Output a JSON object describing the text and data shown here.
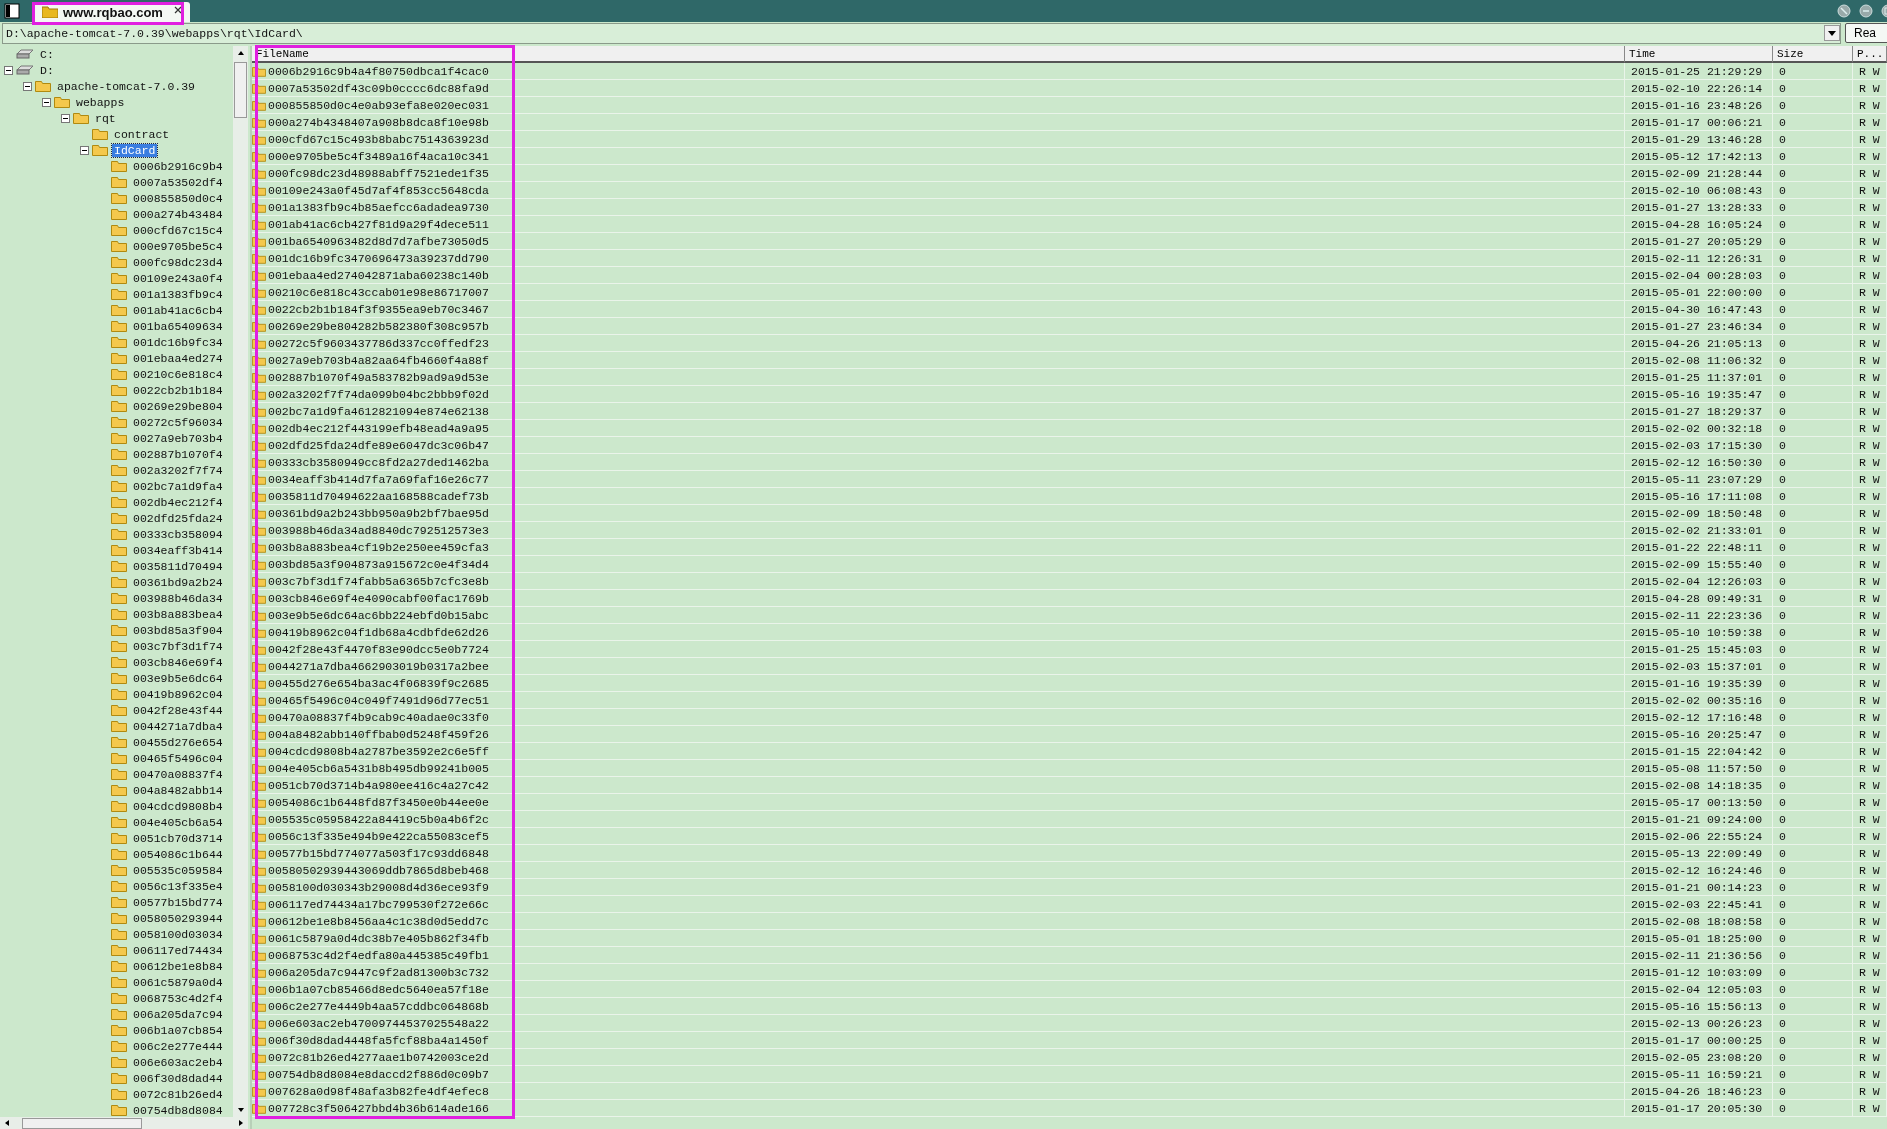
{
  "window": {
    "tab": "www.rqbao.com"
  },
  "address_bar": {
    "path": "D:\\apache-tomcat-7.0.39\\webapps\\rqt\\IdCard\\",
    "button": "Rea"
  },
  "tree": [
    {
      "label": "C:",
      "kind": "drive",
      "selected": false
    },
    {
      "label": "D:",
      "kind": "drive",
      "selected": false,
      "expanded": true,
      "children": [
        {
          "label": "apache-tomcat-7.0.39",
          "kind": "folder",
          "selected": false,
          "expanded": true,
          "children": [
            {
              "label": "webapps",
              "kind": "folder",
              "selected": false,
              "expanded": true,
              "children": [
                {
                  "label": "rqt",
                  "kind": "folder",
                  "selected": false,
                  "expanded": true,
                  "children": [
                    {
                      "label": "contract",
                      "kind": "folder",
                      "selected": false
                    },
                    {
                      "label": "IdCard",
                      "kind": "folder",
                      "selected": true,
                      "expanded": true,
                      "children": [
                        {
                          "label": "0006b2916c9b4",
                          "kind": "folder",
                          "selected": false
                        },
                        {
                          "label": "0007a53502df4",
                          "kind": "folder",
                          "selected": false
                        },
                        {
                          "label": "000855850d0c4",
                          "kind": "folder",
                          "selected": false
                        },
                        {
                          "label": "000a274b43484",
                          "kind": "folder",
                          "selected": false
                        },
                        {
                          "label": "000cfd67c15c4",
                          "kind": "folder",
                          "selected": false
                        },
                        {
                          "label": "000e9705be5c4",
                          "kind": "folder",
                          "selected": false
                        },
                        {
                          "label": "000fc98dc23d4",
                          "kind": "folder",
                          "selected": false
                        },
                        {
                          "label": "00109e243a0f4",
                          "kind": "folder",
                          "selected": false
                        },
                        {
                          "label": "001a1383fb9c4",
                          "kind": "folder",
                          "selected": false
                        },
                        {
                          "label": "001ab41ac6cb4",
                          "kind": "folder",
                          "selected": false
                        },
                        {
                          "label": "001ba65409634",
                          "kind": "folder",
                          "selected": false
                        },
                        {
                          "label": "001dc16b9fc34",
                          "kind": "folder",
                          "selected": false
                        },
                        {
                          "label": "001ebaa4ed274",
                          "kind": "folder",
                          "selected": false
                        },
                        {
                          "label": "00210c6e818c4",
                          "kind": "folder",
                          "selected": false
                        },
                        {
                          "label": "0022cb2b1b184",
                          "kind": "folder",
                          "selected": false
                        },
                        {
                          "label": "00269e29be804",
                          "kind": "folder",
                          "selected": false
                        },
                        {
                          "label": "00272c5f96034",
                          "kind": "folder",
                          "selected": false
                        },
                        {
                          "label": "0027a9eb703b4",
                          "kind": "folder",
                          "selected": false
                        },
                        {
                          "label": "002887b1070f4",
                          "kind": "folder",
                          "selected": false
                        },
                        {
                          "label": "002a3202f7f74",
                          "kind": "folder",
                          "selected": false
                        },
                        {
                          "label": "002bc7a1d9fa4",
                          "kind": "folder",
                          "selected": false
                        },
                        {
                          "label": "002db4ec212f4",
                          "kind": "folder",
                          "selected": false
                        },
                        {
                          "label": "002dfd25fda24",
                          "kind": "folder",
                          "selected": false
                        },
                        {
                          "label": "00333cb358094",
                          "kind": "folder",
                          "selected": false
                        },
                        {
                          "label": "0034eaff3b414",
                          "kind": "folder",
                          "selected": false
                        },
                        {
                          "label": "0035811d70494",
                          "kind": "folder",
                          "selected": false
                        },
                        {
                          "label": "00361bd9a2b24",
                          "kind": "folder",
                          "selected": false
                        },
                        {
                          "label": "003988b46da34",
                          "kind": "folder",
                          "selected": false
                        },
                        {
                          "label": "003b8a883bea4",
                          "kind": "folder",
                          "selected": false
                        },
                        {
                          "label": "003bd85a3f904",
                          "kind": "folder",
                          "selected": false
                        },
                        {
                          "label": "003c7bf3d1f74",
                          "kind": "folder",
                          "selected": false
                        },
                        {
                          "label": "003cb846e69f4",
                          "kind": "folder",
                          "selected": false
                        },
                        {
                          "label": "003e9b5e6dc64",
                          "kind": "folder",
                          "selected": false
                        },
                        {
                          "label": "00419b8962c04",
                          "kind": "folder",
                          "selected": false
                        },
                        {
                          "label": "0042f28e43f44",
                          "kind": "folder",
                          "selected": false
                        },
                        {
                          "label": "0044271a7dba4",
                          "kind": "folder",
                          "selected": false
                        },
                        {
                          "label": "00455d276e654",
                          "kind": "folder",
                          "selected": false
                        },
                        {
                          "label": "00465f5496c04",
                          "kind": "folder",
                          "selected": false
                        },
                        {
                          "label": "00470a08837f4",
                          "kind": "folder",
                          "selected": false
                        },
                        {
                          "label": "004a8482abb14",
                          "kind": "folder",
                          "selected": false
                        },
                        {
                          "label": "004cdcd9808b4",
                          "kind": "folder",
                          "selected": false
                        },
                        {
                          "label": "004e405cb6a54",
                          "kind": "folder",
                          "selected": false
                        },
                        {
                          "label": "0051cb70d3714",
                          "kind": "folder",
                          "selected": false
                        },
                        {
                          "label": "0054086c1b644",
                          "kind": "folder",
                          "selected": false
                        },
                        {
                          "label": "005535c059584",
                          "kind": "folder",
                          "selected": false
                        },
                        {
                          "label": "0056c13f335e4",
                          "kind": "folder",
                          "selected": false
                        },
                        {
                          "label": "00577b15bd774",
                          "kind": "folder",
                          "selected": false
                        },
                        {
                          "label": "0058050293944",
                          "kind": "folder",
                          "selected": false
                        },
                        {
                          "label": "0058100d03034",
                          "kind": "folder",
                          "selected": false
                        },
                        {
                          "label": "006117ed74434",
                          "kind": "folder",
                          "selected": false
                        },
                        {
                          "label": "00612be1e8b84",
                          "kind": "folder",
                          "selected": false
                        },
                        {
                          "label": "0061c5879a0d4",
                          "kind": "folder",
                          "selected": false
                        },
                        {
                          "label": "0068753c4d2f4",
                          "kind": "folder",
                          "selected": false
                        },
                        {
                          "label": "006a205da7c94",
                          "kind": "folder",
                          "selected": false
                        },
                        {
                          "label": "006b1a07cb854",
                          "kind": "folder",
                          "selected": false
                        },
                        {
                          "label": "006c2e277e444",
                          "kind": "folder",
                          "selected": false
                        },
                        {
                          "label": "006e603ac2eb4",
                          "kind": "folder",
                          "selected": false
                        },
                        {
                          "label": "006f30d8dad44",
                          "kind": "folder",
                          "selected": false
                        },
                        {
                          "label": "0072c81b26ed4",
                          "kind": "folder",
                          "selected": false
                        },
                        {
                          "label": "00754db8d8084",
                          "kind": "folder",
                          "selected": false
                        }
                      ]
                    }
                  ]
                }
              ]
            }
          ]
        }
      ]
    }
  ],
  "table": {
    "columns": [
      "FileName",
      "Time",
      "Size",
      "P..."
    ],
    "rows": [
      {
        "name": "0006b2916c9b4a4f80750dbca1f4cac0",
        "time": "2015-01-25 21:29:29",
        "size": "0",
        "perms": "R W"
      },
      {
        "name": "0007a53502df43c09b0cccc6dc88fa9d",
        "time": "2015-02-10 22:26:14",
        "size": "0",
        "perms": "R W"
      },
      {
        "name": "000855850d0c4e0ab93efa8e020ec031",
        "time": "2015-01-16 23:48:26",
        "size": "0",
        "perms": "R W"
      },
      {
        "name": "000a274b4348407a908b8dca8f10e98b",
        "time": "2015-01-17 00:06:21",
        "size": "0",
        "perms": "R W"
      },
      {
        "name": "000cfd67c15c493b8babc7514363923d",
        "time": "2015-01-29 13:46:28",
        "size": "0",
        "perms": "R W"
      },
      {
        "name": "000e9705be5c4f3489a16f4aca10c341",
        "time": "2015-05-12 17:42:13",
        "size": "0",
        "perms": "R W"
      },
      {
        "name": "000fc98dc23d48988abff7521ede1f35",
        "time": "2015-02-09 21:28:44",
        "size": "0",
        "perms": "R W"
      },
      {
        "name": "00109e243a0f45d7af4f853cc5648cda",
        "time": "2015-02-10 06:08:43",
        "size": "0",
        "perms": "R W"
      },
      {
        "name": "001a1383fb9c4b85aefcc6adadea9730",
        "time": "2015-01-27 13:28:33",
        "size": "0",
        "perms": "R W"
      },
      {
        "name": "001ab41ac6cb427f81d9a29f4dece511",
        "time": "2015-04-28 16:05:24",
        "size": "0",
        "perms": "R W"
      },
      {
        "name": "001ba6540963482d8d7d7afbe73050d5",
        "time": "2015-01-27 20:05:29",
        "size": "0",
        "perms": "R W"
      },
      {
        "name": "001dc16b9fc3470696473a39237dd790",
        "time": "2015-02-11 12:26:31",
        "size": "0",
        "perms": "R W"
      },
      {
        "name": "001ebaa4ed274042871aba60238c140b",
        "time": "2015-02-04 00:28:03",
        "size": "0",
        "perms": "R W"
      },
      {
        "name": "00210c6e818c43ccab01e98e86717007",
        "time": "2015-05-01 22:00:00",
        "size": "0",
        "perms": "R W"
      },
      {
        "name": "0022cb2b1b184f3f9355ea9eb70c3467",
        "time": "2015-04-30 16:47:43",
        "size": "0",
        "perms": "R W"
      },
      {
        "name": "00269e29be804282b582380f308c957b",
        "time": "2015-01-27 23:46:34",
        "size": "0",
        "perms": "R W"
      },
      {
        "name": "00272c5f9603437786d337cc0ffedf23",
        "time": "2015-04-26 21:05:13",
        "size": "0",
        "perms": "R W"
      },
      {
        "name": "0027a9eb703b4a82aa64fb4660f4a88f",
        "time": "2015-02-08 11:06:32",
        "size": "0",
        "perms": "R W"
      },
      {
        "name": "002887b1070f49a583782b9ad9a9d53e",
        "time": "2015-01-25 11:37:01",
        "size": "0",
        "perms": "R W"
      },
      {
        "name": "002a3202f7f74da099b04bc2bbb9f02d",
        "time": "2015-05-16 19:35:47",
        "size": "0",
        "perms": "R W"
      },
      {
        "name": "002bc7a1d9fa4612821094e874e62138",
        "time": "2015-01-27 18:29:37",
        "size": "0",
        "perms": "R W"
      },
      {
        "name": "002db4ec212f443199efb48ead4a9a95",
        "time": "2015-02-02 00:32:18",
        "size": "0",
        "perms": "R W"
      },
      {
        "name": "002dfd25fda24dfe89e6047dc3c06b47",
        "time": "2015-02-03 17:15:30",
        "size": "0",
        "perms": "R W"
      },
      {
        "name": "00333cb3580949cc8fd2a27ded1462ba",
        "time": "2015-02-12 16:50:30",
        "size": "0",
        "perms": "R W"
      },
      {
        "name": "0034eaff3b414d7fa7a69faf16e26c77",
        "time": "2015-05-11 23:07:29",
        "size": "0",
        "perms": "R W"
      },
      {
        "name": "0035811d70494622aa168588cadef73b",
        "time": "2015-05-16 17:11:08",
        "size": "0",
        "perms": "R W"
      },
      {
        "name": "00361bd9a2b243bb950a9b2bf7bae95d",
        "time": "2015-02-09 18:50:48",
        "size": "0",
        "perms": "R W"
      },
      {
        "name": "003988b46da34ad8840dc792512573e3",
        "time": "2015-02-02 21:33:01",
        "size": "0",
        "perms": "R W"
      },
      {
        "name": "003b8a883bea4cf19b2e250ee459cfa3",
        "time": "2015-01-22 22:48:11",
        "size": "0",
        "perms": "R W"
      },
      {
        "name": "003bd85a3f904873a915672c0e4f34d4",
        "time": "2015-02-09 15:55:40",
        "size": "0",
        "perms": "R W"
      },
      {
        "name": "003c7bf3d1f74fabb5a6365b7cfc3e8b",
        "time": "2015-02-04 12:26:03",
        "size": "0",
        "perms": "R W"
      },
      {
        "name": "003cb846e69f4e4090cabf00fac1769b",
        "time": "2015-04-28 09:49:31",
        "size": "0",
        "perms": "R W"
      },
      {
        "name": "003e9b5e6dc64ac6bb224ebfd0b15abc",
        "time": "2015-02-11 22:23:36",
        "size": "0",
        "perms": "R W"
      },
      {
        "name": "00419b8962c04f1db68a4cdbfde62d26",
        "time": "2015-05-10 10:59:38",
        "size": "0",
        "perms": "R W"
      },
      {
        "name": "0042f28e43f4470f83e90dcc5e0b7724",
        "time": "2015-01-25 15:45:03",
        "size": "0",
        "perms": "R W"
      },
      {
        "name": "0044271a7dba4662903019b0317a2bee",
        "time": "2015-02-03 15:37:01",
        "size": "0",
        "perms": "R W"
      },
      {
        "name": "00455d276e654ba3ac4f06839f9c2685",
        "time": "2015-01-16 19:35:39",
        "size": "0",
        "perms": "R W"
      },
      {
        "name": "00465f5496c04c049f7491d96d77ec51",
        "time": "2015-02-02 00:35:16",
        "size": "0",
        "perms": "R W"
      },
      {
        "name": "00470a08837f4b9cab9c40adae0c33f0",
        "time": "2015-02-12 17:16:48",
        "size": "0",
        "perms": "R W"
      },
      {
        "name": "004a8482abb140ffbab0d5248f459f26",
        "time": "2015-05-16 20:25:47",
        "size": "0",
        "perms": "R W"
      },
      {
        "name": "004cdcd9808b4a2787be3592e2c6e5ff",
        "time": "2015-01-15 22:04:42",
        "size": "0",
        "perms": "R W"
      },
      {
        "name": "004e405cb6a5431b8b495db99241b005",
        "time": "2015-05-08 11:57:50",
        "size": "0",
        "perms": "R W"
      },
      {
        "name": "0051cb70d3714b4a980ee416c4a27c42",
        "time": "2015-02-08 14:18:35",
        "size": "0",
        "perms": "R W"
      },
      {
        "name": "0054086c1b6448fd87f3450e0b44ee0e",
        "time": "2015-05-17 00:13:50",
        "size": "0",
        "perms": "R W"
      },
      {
        "name": "005535c05958422a84419c5b0a4b6f2c",
        "time": "2015-01-21 09:24:00",
        "size": "0",
        "perms": "R W"
      },
      {
        "name": "0056c13f335e494b9e422ca55083cef5",
        "time": "2015-02-06 22:55:24",
        "size": "0",
        "perms": "R W"
      },
      {
        "name": "00577b15bd774077a503f17c93dd6848",
        "time": "2015-05-13 22:09:49",
        "size": "0",
        "perms": "R W"
      },
      {
        "name": "00580502939443069ddb7865d8beb468",
        "time": "2015-02-12 16:24:46",
        "size": "0",
        "perms": "R W"
      },
      {
        "name": "0058100d030343b29008d4d36ece93f9",
        "time": "2015-01-21 00:14:23",
        "size": "0",
        "perms": "R W"
      },
      {
        "name": "006117ed74434a17bc799530f272e66c",
        "time": "2015-02-03 22:45:41",
        "size": "0",
        "perms": "R W"
      },
      {
        "name": "00612be1e8b8456aa4c1c38d0d5edd7c",
        "time": "2015-02-08 18:08:58",
        "size": "0",
        "perms": "R W"
      },
      {
        "name": "0061c5879a0d4dc38b7e405b862f34fb",
        "time": "2015-05-01 18:25:00",
        "size": "0",
        "perms": "R W"
      },
      {
        "name": "0068753c4d2f4edfa80a445385c49fb1",
        "time": "2015-02-11 21:36:56",
        "size": "0",
        "perms": "R W"
      },
      {
        "name": "006a205da7c9447c9f2ad81300b3c732",
        "time": "2015-01-12 10:03:09",
        "size": "0",
        "perms": "R W"
      },
      {
        "name": "006b1a07cb85466d8edc5640ea57f18e",
        "time": "2015-02-04 12:05:03",
        "size": "0",
        "perms": "R W"
      },
      {
        "name": "006c2e277e4449b4aa57cddbc064868b",
        "time": "2015-05-16 15:56:13",
        "size": "0",
        "perms": "R W"
      },
      {
        "name": "006e603ac2eb47009744537025548a22",
        "time": "2015-02-13 00:26:23",
        "size": "0",
        "perms": "R W"
      },
      {
        "name": "006f30d8dad4448fa5fcf88ba4a1450f",
        "time": "2015-01-17 00:00:25",
        "size": "0",
        "perms": "R W"
      },
      {
        "name": "0072c81b26ed4277aae1b0742003ce2d",
        "time": "2015-02-05 23:08:20",
        "size": "0",
        "perms": "R W"
      },
      {
        "name": "00754db8d8084e8daccd2f886d0c09b7",
        "time": "2015-05-11 16:59:21",
        "size": "0",
        "perms": "R W"
      },
      {
        "name": "007628a0d98f48afa3b82fe4df4efec8",
        "time": "2015-04-26 18:46:23",
        "size": "0",
        "perms": "R W"
      },
      {
        "name": "007728c3f506427bbd4b36b614ade166",
        "time": "2015-01-17 20:05:30",
        "size": "0",
        "perms": "R W"
      }
    ]
  }
}
